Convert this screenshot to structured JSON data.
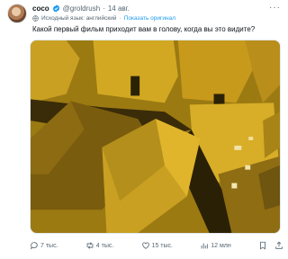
{
  "tweet": {
    "display_name": "coco",
    "handle": "@groldrush",
    "separator": "·",
    "date": "14 авг.",
    "more": "···",
    "translation_note": "Исходный язык: английский",
    "translation_separator": "·",
    "show_original": "Показать оригинал",
    "text": "Какой первый фильм приходит вам в голову, когда вы это видите?"
  },
  "actions": {
    "replies": "7 тыс.",
    "retweets": "4 тыс.",
    "likes": "15 тыс.",
    "views": "12 млн"
  },
  "icons": {
    "verified": "verified-badge-icon",
    "globe": "globe-icon",
    "reply": "reply-icon",
    "retweet": "retweet-icon",
    "like": "heart-icon",
    "views": "views-icon",
    "bookmark": "bookmark-icon",
    "share": "share-icon"
  },
  "colors": {
    "accent": "#1d9bf0",
    "muted": "#536471",
    "image_tone": "#c79a1c"
  }
}
